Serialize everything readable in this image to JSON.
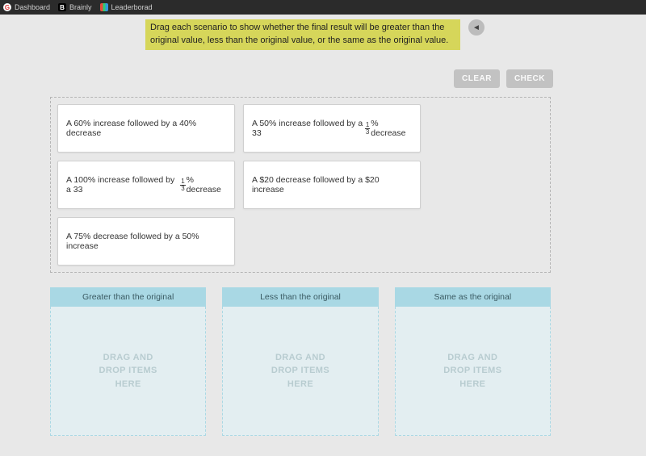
{
  "bookmarks": [
    {
      "label": "Dashboard",
      "icon_name": "g-icon",
      "icon_key": "G"
    },
    {
      "label": "Brainly",
      "icon_name": "b-icon",
      "icon_key": "B"
    },
    {
      "label": "Leaderborad",
      "icon_name": "lb-icon",
      "icon_key": ""
    }
  ],
  "instructions": "Drag each scenario to show whether the final result will be greater than the original value, less than the original value, or the same as the original value.",
  "audio_icon": "◄",
  "controls": {
    "clear": "CLEAR",
    "check": "CHECK"
  },
  "cards": [
    {
      "html": "A 60% increase followed by a 40% decrease"
    },
    {
      "html": "A 50% increase followed by a 33<span class='frac'><span class='n'>1</span><span class='d'>3</span></span>% decrease"
    },
    {
      "html": "A 100% increase followed by a 33<span class='frac'><span class='n'>1</span><span class='d'>3</span></span>% decrease"
    },
    {
      "html": "A $20 decrease followed by a $20 increase"
    },
    {
      "html": "A 75% decrease followed by a 50% increase"
    }
  ],
  "drop_columns": [
    "Greater than the original",
    "Less than the original",
    "Same as the original"
  ],
  "drop_placeholder": "DRAG AND\nDROP ITEMS\nHERE"
}
